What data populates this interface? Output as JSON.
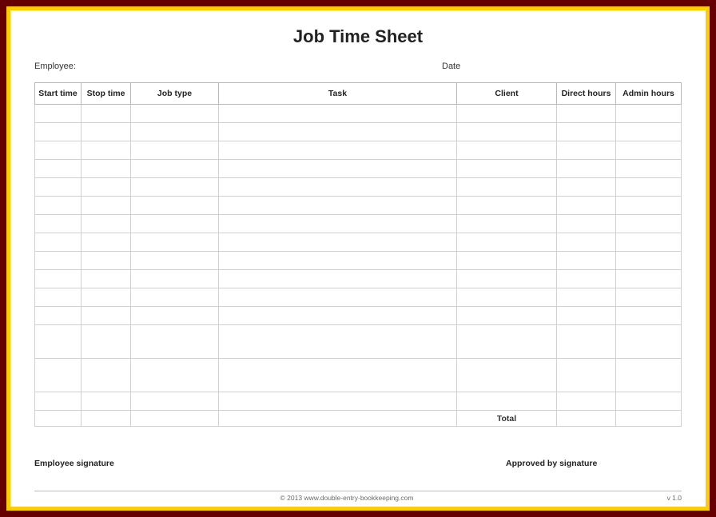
{
  "title": "Job Time Sheet",
  "meta": {
    "employee_label": "Employee:",
    "date_label": "Date"
  },
  "table": {
    "headers": {
      "start": "Start time",
      "stop": "Stop time",
      "jobtype": "Job type",
      "task": "Task",
      "client": "Client",
      "direct": "Direct hours",
      "admin": "Admin hours"
    },
    "total_label": "Total"
  },
  "signatures": {
    "employee": "Employee signature",
    "approved": "Approved by signature"
  },
  "footer": {
    "copyright": "© 2013 www.double-entry-bookkeeping.com",
    "version": "v 1.0"
  }
}
